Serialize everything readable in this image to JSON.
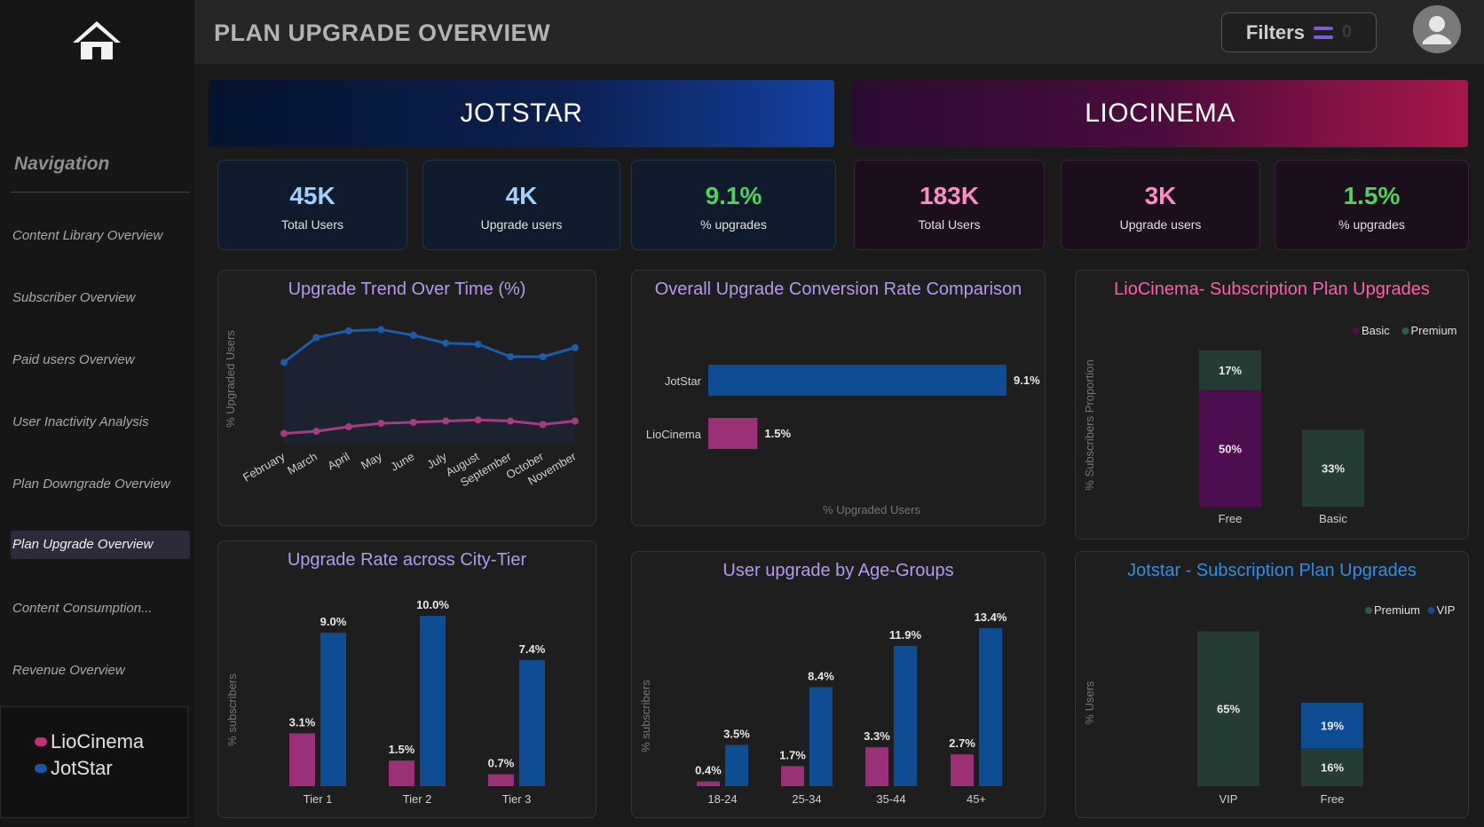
{
  "header": {
    "title": "PLAN UPGRADE OVERVIEW",
    "filters_label": "Filters",
    "filters_count": "0"
  },
  "sidebar": {
    "title": "Navigation",
    "items": [
      {
        "label": "Content Library Overview"
      },
      {
        "label": "Subscriber Overview"
      },
      {
        "label": "Paid users Overview"
      },
      {
        "label": "User Inactivity Analysis"
      },
      {
        "label": "Plan Downgrade Overview"
      },
      {
        "label": "Plan Upgrade Overview",
        "active": true
      },
      {
        "label": "Content Consumption..."
      },
      {
        "label": "Revenue Overview"
      }
    ],
    "legend": [
      {
        "label": "LioCinema",
        "color": "#c2307a"
      },
      {
        "label": "JotStar",
        "color": "#1656a8"
      }
    ]
  },
  "banners": {
    "jotstar": "JOTSTAR",
    "liocinema": "LIOCINEMA"
  },
  "kpis": {
    "jotstar": [
      {
        "value": "45K",
        "label": "Total Users",
        "color": "#9fd0ff"
      },
      {
        "value": "4K",
        "label": "Upgrade users",
        "color": "#9fd0ff"
      },
      {
        "value": "9.1%",
        "label": "% upgrades",
        "color": "#4dd35a"
      }
    ],
    "liocinema": [
      {
        "value": "183K",
        "label": "Total Users",
        "color": "#ff8cc6"
      },
      {
        "value": "3K",
        "label": "Upgrade users",
        "color": "#ff8cc6"
      },
      {
        "value": "1.5%",
        "label": "% upgrades",
        "color": "#4dd35a"
      }
    ]
  },
  "colors": {
    "jotstar": "#0e4c94",
    "liocinema": "#9c3078",
    "premium": "#243c34",
    "basic": "#4c0e4e",
    "vip": "#0e4c94"
  },
  "chart_data": [
    {
      "id": "trend",
      "type": "line",
      "title": "Upgrade Trend Over Time (%)",
      "ylabel": "% Upgraded Users",
      "categories": [
        "February",
        "March",
        "April",
        "May",
        "June",
        "July",
        "August",
        "September",
        "October",
        "November"
      ],
      "series": [
        {
          "values": [
            7.2,
            9.4,
            10.0,
            10.1,
            9.6,
            8.9,
            8.8,
            7.7,
            7.7,
            8.5
          ]
        },
        {
          "values": [
            0.9,
            1.1,
            1.5,
            1.8,
            1.9,
            2.0,
            2.1,
            2.0,
            1.7,
            2.0
          ]
        }
      ]
    },
    {
      "id": "conversion",
      "type": "bar",
      "orientation": "horizontal",
      "title": "Overall Upgrade Conversion Rate Comparison",
      "xlabel": "% Upgraded Users",
      "categories": [
        "JotStar",
        "LioCinema"
      ],
      "values": [
        9.1,
        1.5
      ],
      "labels": [
        "9.1%",
        "1.5%"
      ]
    },
    {
      "id": "lio-plans",
      "type": "bar",
      "stacked": true,
      "title": "LioCinema- Subscription Plan Upgrades",
      "ylabel": "% Subscribers Proportion",
      "categories": [
        "Free",
        "Basic"
      ],
      "series": [
        {
          "name": "Basic",
          "values": [
            50,
            0
          ],
          "labels": [
            "50%",
            ""
          ]
        },
        {
          "name": "Premium",
          "values": [
            17,
            33
          ],
          "labels": [
            "17%",
            "33%"
          ]
        }
      ]
    },
    {
      "id": "city-tier",
      "type": "bar",
      "title": "Upgrade Rate across City-Tier",
      "ylabel": "% subscribers",
      "categories": [
        "Tier 1",
        "Tier 2",
        "Tier 3"
      ],
      "series": [
        {
          "values": [
            3.1,
            1.5,
            0.7
          ],
          "labels": [
            "3.1%",
            "1.5%",
            "0.7%"
          ]
        },
        {
          "values": [
            9.0,
            10.0,
            7.4
          ],
          "labels": [
            "9.0%",
            "10.0%",
            "7.4%"
          ]
        }
      ]
    },
    {
      "id": "age-groups",
      "type": "bar",
      "title": "User upgrade by Age-Groups",
      "ylabel": "% subscribers",
      "categories": [
        "18-24",
        "25-34",
        "35-44",
        "45+"
      ],
      "series": [
        {
          "values": [
            0.4,
            1.7,
            3.3,
            2.7
          ],
          "labels": [
            "0.4%",
            "1.7%",
            "3.3%",
            "2.7%"
          ]
        },
        {
          "values": [
            3.5,
            8.4,
            11.9,
            13.4
          ],
          "labels": [
            "3.5%",
            "8.4%",
            "11.9%",
            "13.4%"
          ]
        }
      ]
    },
    {
      "id": "jot-plans",
      "type": "bar",
      "stacked": true,
      "title": "Jotstar - Subscription Plan Upgrades",
      "ylabel": "% Users",
      "categories": [
        "VIP",
        "Free"
      ],
      "series": [
        {
          "name": "Premium",
          "values": [
            65,
            16
          ],
          "labels": [
            "65%",
            "16%"
          ]
        },
        {
          "name": "VIP",
          "values": [
            0,
            19
          ],
          "labels": [
            "",
            "19%"
          ]
        }
      ]
    }
  ]
}
